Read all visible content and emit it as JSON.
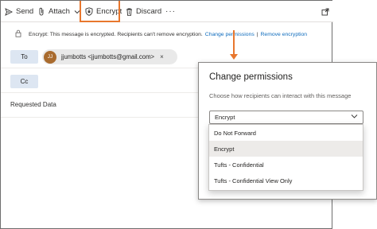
{
  "toolbar": {
    "send_label": "Send",
    "attach_label": "Attach",
    "encrypt_label": "Encrypt",
    "discard_label": "Discard",
    "more_label": "···"
  },
  "info_bar": {
    "message": "Encrypt: This message is encrypted. Recipients can't remove encryption.",
    "change_permissions": "Change permissions",
    "divider": "|",
    "remove_encryption": "Remove encryption"
  },
  "to_field": {
    "label": "To",
    "recipient_initials": "JJ",
    "recipient": "jjumbotts <jjumbotts@gmail.com>",
    "remove": "×"
  },
  "cc_field": {
    "label": "Cc"
  },
  "subject": "Requested Data",
  "dialog": {
    "title": "Change permissions",
    "description": "Choose how recipients can interact with this message",
    "selected_value": "Encrypt",
    "options": [
      "Do Not Forward",
      "Encrypt",
      "Tufts - Confidential",
      "Tufts - Confidential View Only"
    ],
    "selected_index": 1
  },
  "colors": {
    "accent_orange": "#e8772e",
    "link_blue": "#0f6cbd",
    "field_button_bg": "#dde6f2",
    "avatar_bg": "#a96b2e"
  }
}
